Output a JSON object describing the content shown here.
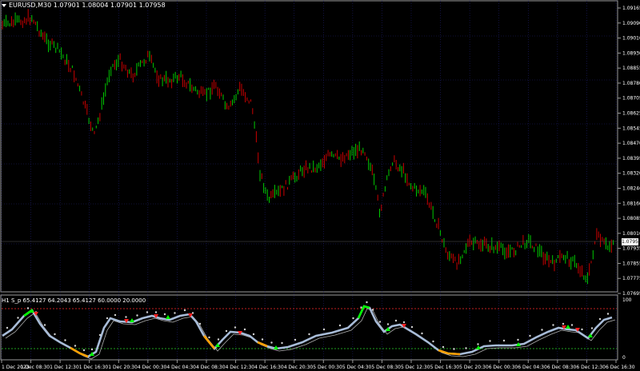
{
  "main_panel": {
    "title": "EURUSD,M30  1.07901 1.08004 1.07901 1.07958",
    "price_labels": [
      "1.09165",
      "1.09090",
      "1.09010",
      "1.08930",
      "1.08855",
      "1.08780",
      "1.08705",
      "1.08625",
      "1.08545",
      "1.08470",
      "1.08395",
      "1.08320",
      "1.08240",
      "1.08160",
      "1.08085",
      "1.08010",
      "1.07935",
      "1.07855",
      "1.07775",
      "1.07695"
    ],
    "current_price_tag": "1.07958"
  },
  "sub_panel": {
    "title": "H1 S_p 65.4127 64.2043 65.4127 60.0000 20.0000",
    "scale_labels": [
      "100",
      "0"
    ]
  },
  "time_labels": [
    "1 Dec 2023",
    "1 Dec 08:30",
    "1 Dec 12:30",
    "1 Dec 16:30",
    "1 Dec 20:30",
    "4 Dec 00:30",
    "4 Dec 04:30",
    "4 Dec 08:30",
    "4 Dec 12:30",
    "4 Dec 16:30",
    "4 Dec 20:30",
    "5 Dec 00:30",
    "5 Dec 04:30",
    "5 Dec 08:30",
    "5 Dec 12:30",
    "5 Dec 16:30",
    "5 Dec 20:30",
    "6 Dec 00:30",
    "6 Dec 04:30",
    "6 Dec 08:30",
    "6 Dec 12:30",
    "6 Dec 16:30"
  ],
  "colors": {
    "bull_candle": "#00c800",
    "bear_candle": "#c80000",
    "grid": "#1e1e6e",
    "osc_line": "#a8bcd8",
    "osc_signal": "#b0b0b0",
    "level_upper": "#c02020",
    "level_lower": "#20a020",
    "segment_up": "#00ff00",
    "segment_down": "#ffa000"
  }
}
